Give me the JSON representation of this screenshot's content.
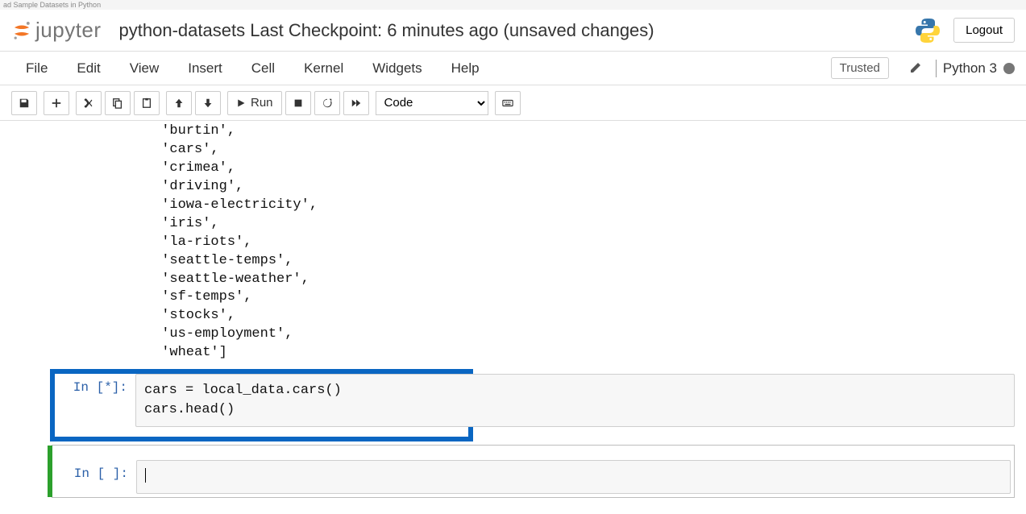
{
  "topbar_hint": "ad Sample Datasets in Python",
  "header": {
    "logo_text": "jupyter",
    "title": "python-datasets Last Checkpoint: 6 minutes ago  (unsaved changes)",
    "logout": "Logout"
  },
  "menubar": {
    "items": [
      "File",
      "Edit",
      "View",
      "Insert",
      "Cell",
      "Kernel",
      "Widgets",
      "Help"
    ],
    "trusted": "Trusted",
    "kernel": "Python 3"
  },
  "toolbar": {
    "run_label": "Run",
    "cell_type": "Code"
  },
  "output_lines": [
    " 'burtin',",
    " 'cars',",
    " 'crimea',",
    " 'driving',",
    " 'iowa-electricity',",
    " 'iris',",
    " 'la-riots',",
    " 'seattle-temps',",
    " 'seattle-weather',",
    " 'sf-temps',",
    " 'stocks',",
    " 'us-employment',",
    " 'wheat']"
  ],
  "cells": [
    {
      "prompt": "In [*]:",
      "code": "cars = local_data.cars()\ncars.head()"
    },
    {
      "prompt": "In [ ]:",
      "code": ""
    }
  ]
}
